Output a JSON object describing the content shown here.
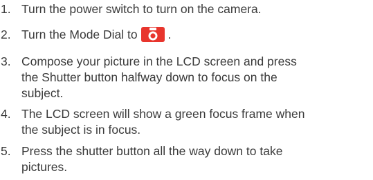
{
  "steps": [
    {
      "number": "1.",
      "text": "Turn the power switch to turn on the camera."
    },
    {
      "number": "2.",
      "text_before": "Turn the Mode Dial to",
      "text_after": ".",
      "icon": "camera-mode-icon",
      "icon_color": "#e8352d"
    },
    {
      "number": "3.",
      "lines": [
        "Compose your picture in the LCD screen and press",
        "the Shutter button halfway down to focus on the",
        "subject."
      ]
    },
    {
      "number": "4.",
      "lines": [
        "The LCD screen will show a green focus frame when",
        "the subject is in focus."
      ]
    },
    {
      "number": "5.",
      "lines": [
        "Press the shutter button all the way down to take",
        "pictures."
      ]
    }
  ]
}
